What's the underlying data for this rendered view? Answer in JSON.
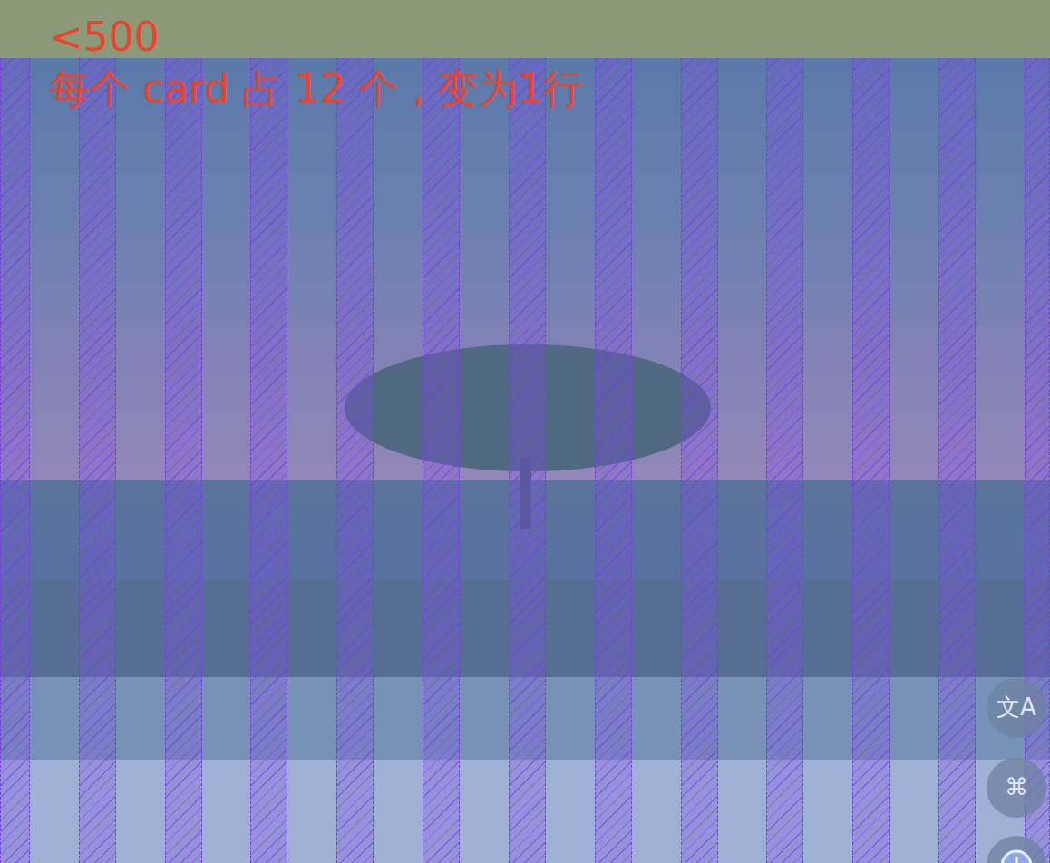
{
  "labels": [
    "<500",
    "每个 card 占 12 个，变为1行"
  ],
  "grid": {
    "columns": 12
  },
  "floating_buttons": [
    {
      "label": "文A"
    },
    {
      "label": "⌘"
    }
  ]
}
